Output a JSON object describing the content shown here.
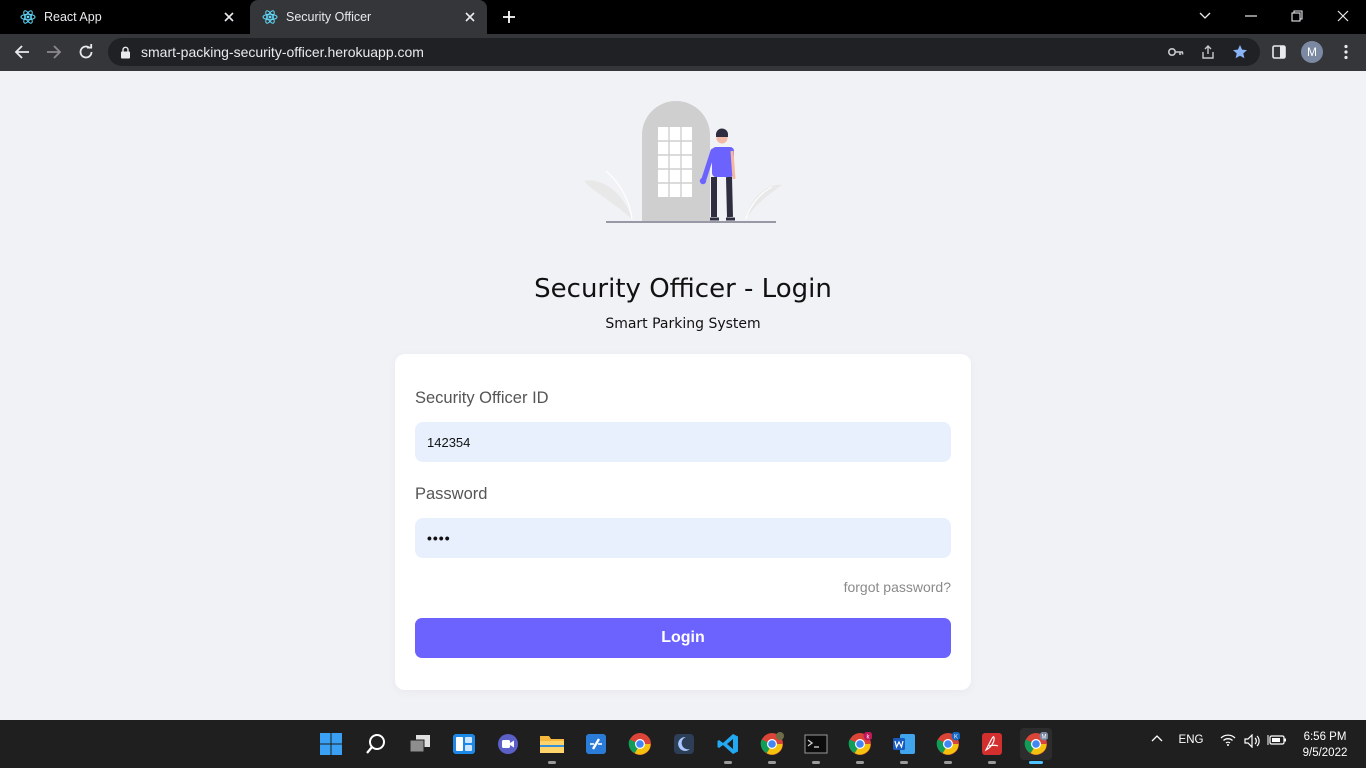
{
  "browser": {
    "tabs": [
      {
        "title": "React App",
        "favicon": "react-icon"
      },
      {
        "title": "Security Officer",
        "favicon": "react-icon",
        "active": true
      }
    ],
    "url": "smart-packing-security-officer.herokuapp.com",
    "profile_initial": "M"
  },
  "page": {
    "title": "Security Officer - Login",
    "subtitle": "Smart Parking System",
    "form": {
      "id_label": "Security Officer ID",
      "id_value": "142354",
      "password_label": "Password",
      "password_value": "••••",
      "forgot_label": "forgot password?",
      "login_label": "Login"
    },
    "colors": {
      "accent": "#6c63ff",
      "field_bg": "#e8f0fe",
      "page_bg": "#f1f2f6"
    }
  },
  "taskbar": {
    "language": "ENG",
    "time": "6:56 PM",
    "date": "9/5/2022",
    "badges": {
      "chrome_k1": "k",
      "chrome_k2": "K",
      "chrome_active": "M"
    }
  }
}
